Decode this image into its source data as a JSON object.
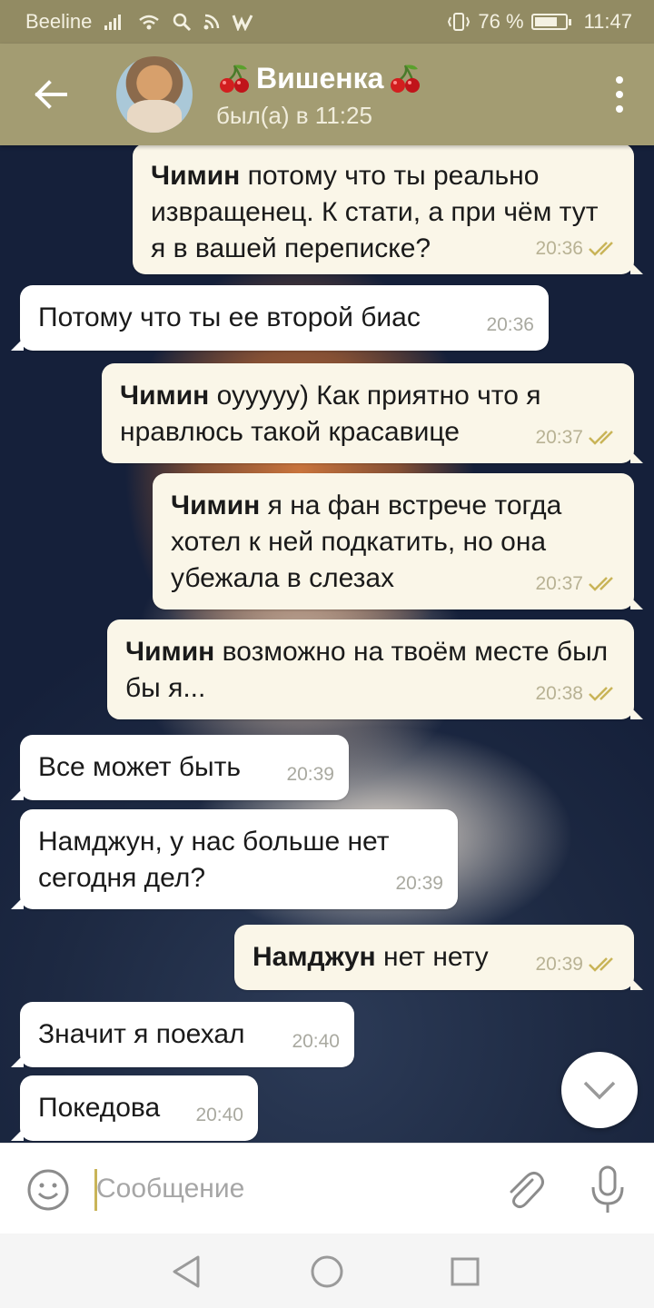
{
  "status_bar": {
    "carrier": "Beeline",
    "battery": "76 %",
    "battery_level": 0.76,
    "time": "11:47"
  },
  "header": {
    "back_icon": "arrow-left-icon",
    "name": "Вишенка",
    "name_decor_icon": "cherry-icon",
    "last_seen": "был(а) в 11:25",
    "menu_icon": "more-vertical-icon"
  },
  "messages": [
    {
      "dir": "out",
      "author": "Чимин",
      "text": " потому что ты реально извращенец. К стати, а при чём тут я в вашей переписке?",
      "time": "20:36",
      "read": true
    },
    {
      "dir": "in",
      "author": "",
      "text": "Потому что ты ее второй биас",
      "time": "20:36"
    },
    {
      "dir": "out",
      "author": "Чимин",
      "text": " оууууу) Как приятно что я нравлюсь такой красавице",
      "time": "20:37",
      "read": true
    },
    {
      "dir": "out",
      "author": "Чимин",
      "text": " я на фан встрече тогда хотел к ней подкатить, но она убежала в слезах",
      "time": "20:37",
      "read": true
    },
    {
      "dir": "out",
      "author": "Чимин",
      "text": " возможно на твоём месте был бы я...",
      "time": "20:38",
      "read": true
    },
    {
      "dir": "in",
      "author": "",
      "text": "Все может быть",
      "time": "20:39"
    },
    {
      "dir": "in",
      "author": "",
      "text": "Намджун, у нас больше нет сегодня дел?",
      "time": "20:39"
    },
    {
      "dir": "out",
      "author": "Намджун",
      "text": " нет нету",
      "time": "20:39",
      "read": true
    },
    {
      "dir": "in",
      "author": "",
      "text": "Значит я поехал",
      "time": "20:40"
    },
    {
      "dir": "in",
      "author": "",
      "text": "Покедова",
      "time": "20:40"
    }
  ],
  "scroll_down_icon": "chevron-down-icon",
  "input": {
    "placeholder": "Сообщение",
    "value": "",
    "emoji_icon": "smiley-icon",
    "attach_icon": "paperclip-icon",
    "mic_icon": "microphone-icon"
  },
  "nav": {
    "back_icon": "triangle-back-icon",
    "home_icon": "circle-home-icon",
    "recents_icon": "square-recents-icon"
  }
}
